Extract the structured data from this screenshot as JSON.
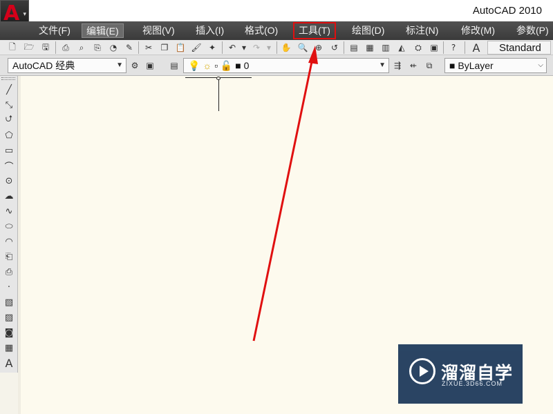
{
  "window": {
    "title": "AutoCAD 2010"
  },
  "app_button": {
    "glyph": "A",
    "caret": "▾"
  },
  "menu": [
    {
      "label": "文件(F)"
    },
    {
      "label": "编辑(E)"
    },
    {
      "label": "视图(V)"
    },
    {
      "label": "插入(I)"
    },
    {
      "label": "格式(O)"
    },
    {
      "label": "工具(T)"
    },
    {
      "label": "绘图(D)"
    },
    {
      "label": "标注(N)"
    },
    {
      "label": "修改(M)"
    },
    {
      "label": "参数(P)"
    }
  ],
  "toolbar": {
    "text_style_value": "Standard",
    "text_style_glyph": "A"
  },
  "workspace": {
    "value": "AutoCAD 经典"
  },
  "layer": {
    "value": "0"
  },
  "color": {
    "value": "ByLayer"
  },
  "draw_tools": {
    "text_glyph": "A"
  },
  "highlight_color": "#e01010",
  "watermark": {
    "title": "溜溜自学",
    "subtitle": "ZIXUE.3D66.COM"
  }
}
